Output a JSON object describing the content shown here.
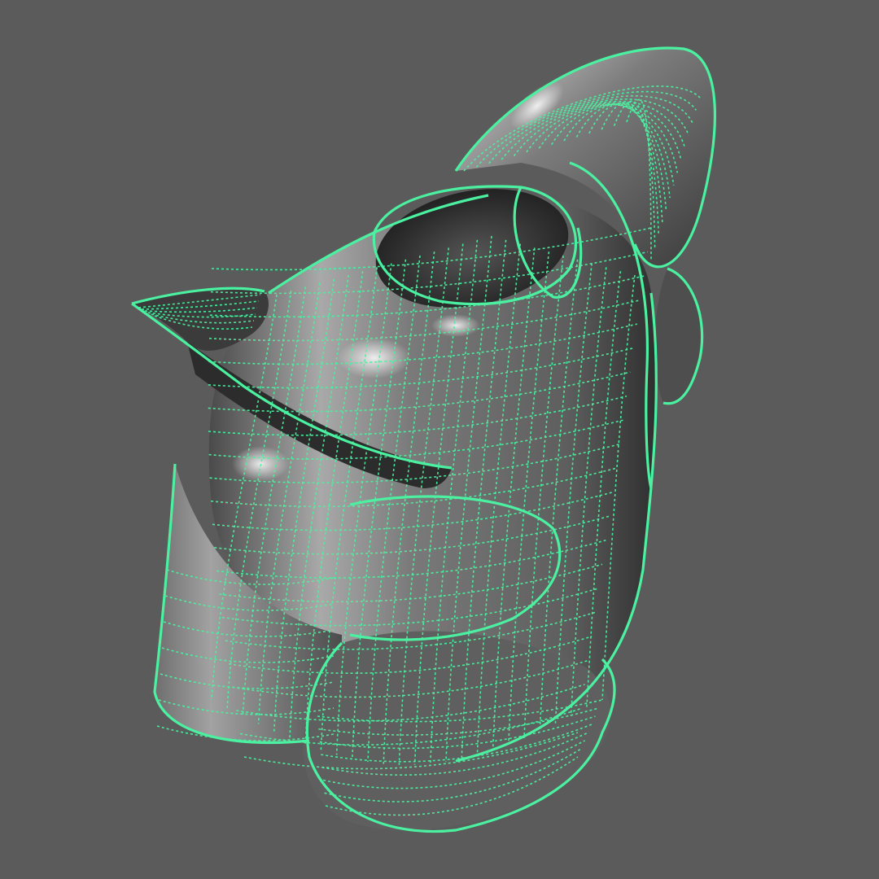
{
  "viewport": {
    "background_color": "#5b5b5b",
    "selection_color": "#4bf0a0",
    "shading": "smooth-shaded-with-wireframe",
    "object_state": "selected"
  },
  "model": {
    "icon": "teapot-mesh-icon"
  }
}
